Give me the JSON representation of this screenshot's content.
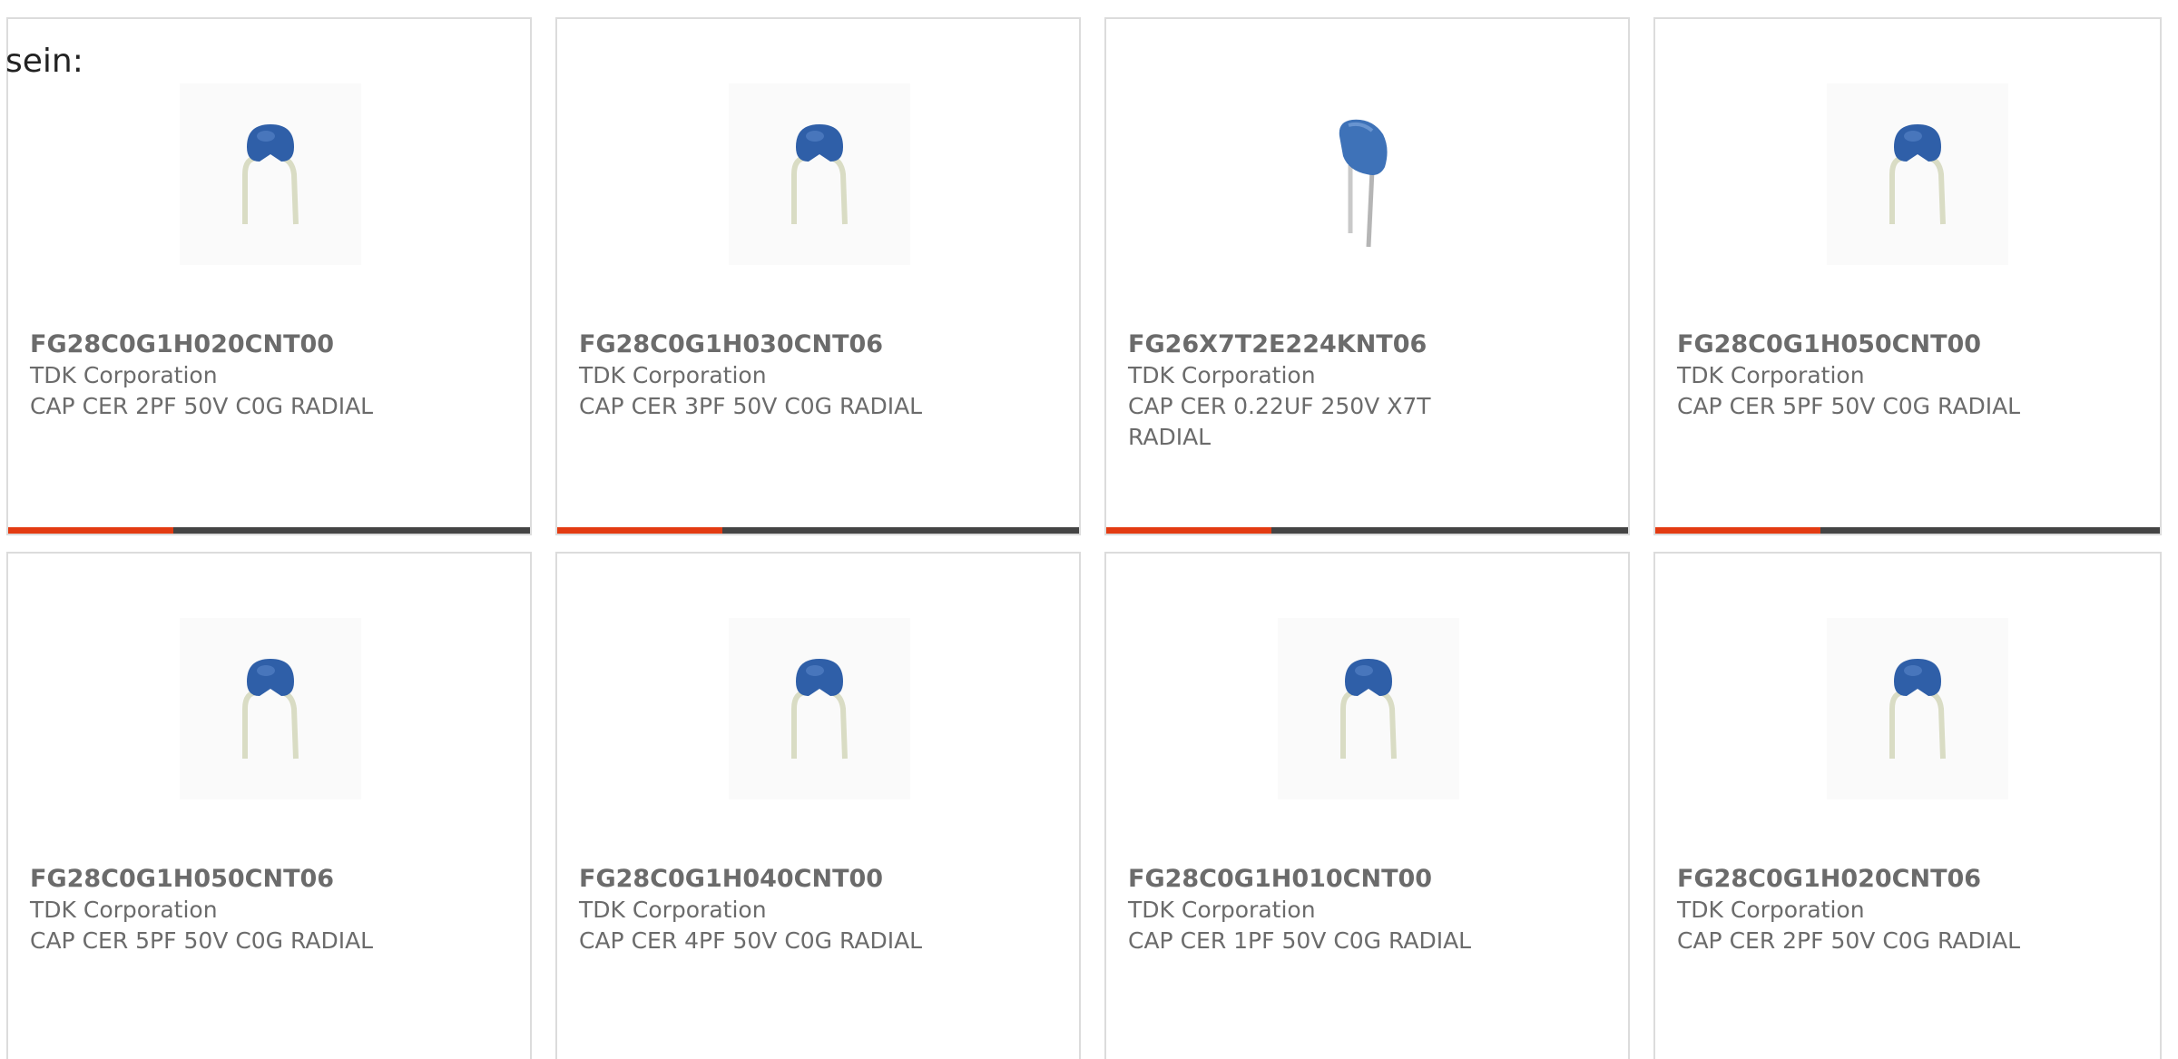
{
  "intro_text": "sein:",
  "colors": {
    "accent": "#e33b12",
    "bar": "#444444",
    "border": "#dcdcdc",
    "text": "#6b6b6b",
    "capacitor_blue": "#2f5fa8"
  },
  "products": [
    {
      "part_number": "FG28C0G1H020CNT00",
      "manufacturer": "TDK Corporation",
      "description": "CAP CER 2PF 50V C0G RADIAL",
      "image_icon": "disc-capacitor-icon"
    },
    {
      "part_number": "FG28C0G1H030CNT06",
      "manufacturer": "TDK Corporation",
      "description": "CAP CER 3PF 50V C0G RADIAL",
      "image_icon": "disc-capacitor-icon"
    },
    {
      "part_number": "FG26X7T2E224KNT06",
      "manufacturer": "TDK Corporation",
      "description": "CAP CER 0.22UF 250V X7T RADIAL",
      "image_icon": "dipped-capacitor-icon"
    },
    {
      "part_number": "FG28C0G1H050CNT00",
      "manufacturer": "TDK Corporation",
      "description": "CAP CER 5PF 50V C0G RADIAL",
      "image_icon": "disc-capacitor-icon"
    },
    {
      "part_number": "FG28C0G1H050CNT06",
      "manufacturer": "TDK Corporation",
      "description": "CAP CER 5PF 50V C0G RADIAL",
      "image_icon": "disc-capacitor-icon"
    },
    {
      "part_number": "FG28C0G1H040CNT00",
      "manufacturer": "TDK Corporation",
      "description": "CAP CER 4PF 50V C0G RADIAL",
      "image_icon": "disc-capacitor-icon"
    },
    {
      "part_number": "FG28C0G1H010CNT00",
      "manufacturer": "TDK Corporation",
      "description": "CAP CER 1PF 50V C0G RADIAL",
      "image_icon": "disc-capacitor-icon"
    },
    {
      "part_number": "FG28C0G1H020CNT06",
      "manufacturer": "TDK Corporation",
      "description": "CAP CER 2PF 50V C0G RADIAL",
      "image_icon": "disc-capacitor-icon"
    }
  ]
}
